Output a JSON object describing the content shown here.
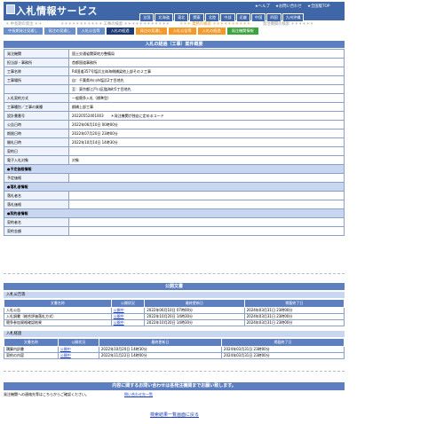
{
  "header": {
    "title": "入札情報サービス",
    "links": [
      "★ヘルプ",
      "★お問い合わせ",
      "★全国版TOP"
    ],
    "regions": [
      "全国",
      "北海道",
      "東北",
      "関東",
      "北陸",
      "中部",
      "近畿",
      "中国",
      "四国",
      "九州沖縄"
    ]
  },
  "search_row": {
    "left": "＊ 中長期の発注 ＊＊",
    "works": "＊＊＊＊＊＊＊＊＊＊＊ 工事の検索 ＊＊＊＊＊＊＊＊＊＊＊＊",
    "business": "＊＊＊ 業務の検索 ＊＊＊＊＊＊＊＊＊＊",
    "agency": "発注機関の検索 ＊＊＊＊＊＊"
  },
  "nav_tabs": [
    "中長期発注見通し",
    "発注の見通し",
    "入札公告等",
    "入札の経過",
    "発注の見通し",
    "入札公告等",
    "入札の経過",
    "発注機関情報"
  ],
  "section_title": "入札の経過（工事）案件概要",
  "details": [
    {
      "k": "発注機関",
      "v": "国土交通省関東地方整備局"
    },
    {
      "k": "担当部・事務所",
      "v": "首都国道事務所"
    },
    {
      "k": "工事名称",
      "v": "R4国道357号塩浜立体海側橋梁他上部その２工事"
    },
    {
      "k": "工事場所",
      "v": "自：千葉県市川市塩浜2丁目地先"
    },
    {
      "k": "",
      "v": "至：東京都江戸川区臨海町5丁目地先"
    },
    {
      "k": "入札契約方式",
      "v": "一般競争入札（標準型）"
    },
    {
      "k": "工事種別／工事の業種",
      "v": "鋼橋上部工事"
    },
    {
      "k": "設計書番号",
      "v": "20220552401003　　＊発注機関が独自に定めるコード"
    },
    {
      "k": "公告日時",
      "v": "2022年06月10日 00時00分"
    },
    {
      "k": "期限日時",
      "v": "2022年07月20日 23時00分"
    },
    {
      "k": "開札日時",
      "v": "2022年10月14日 14時30分"
    },
    {
      "k": "契約日",
      "v": ""
    },
    {
      "k": "電子入札対象",
      "v": "対象"
    },
    {
      "sub": "●予定価格情報"
    },
    {
      "k": "予定価格",
      "v": ""
    },
    {
      "sub": "●落札者情報"
    },
    {
      "k": "落札者名",
      "v": ""
    },
    {
      "k": "落札価格",
      "v": ""
    },
    {
      "sub": "●契約者情報"
    },
    {
      "k": "契約者名",
      "v": ""
    },
    {
      "k": "契約金額",
      "v": ""
    }
  ],
  "public_docs": {
    "title": "公開文書",
    "headers": [
      "文書名称",
      "公開状況",
      "最終更新日",
      "掲載終了日"
    ],
    "groups": [
      {
        "name": "入札公告等",
        "rows": [
          [
            "入札公告",
            "公開中",
            "2022年06月10日 07時00分",
            "2024年03月31日 23時00分"
          ],
          [
            "入札調書（総合評価落札方式）",
            "公開中",
            "2022年10月20日 14時30分",
            "2024年03月31日 23時00分"
          ],
          [
            "競争参加資格確認結果",
            "公開中",
            "2022年10月20日 14時30分",
            "2024年03月31日 23時00分"
          ]
        ]
      },
      {
        "name": "入札経過",
        "rows": [
          [
            "積算内訳書",
            "公開中",
            "2022年10月20日 14時30分",
            "2024年03月31日 23時00分"
          ],
          [
            "契約の内容",
            "公開中",
            "2022年11月22日 14時00分",
            "2024年03月31日 23時00分"
          ]
        ]
      }
    ]
  },
  "inquiry": {
    "title": "内容に関するお問い合わせは各発注機関までお願い致します。",
    "note": "発注機関への連絡先等はこちらからご確認ください。",
    "link": "問い合わせ先一覧"
  },
  "back_link": "検索結果一覧画面に戻る"
}
